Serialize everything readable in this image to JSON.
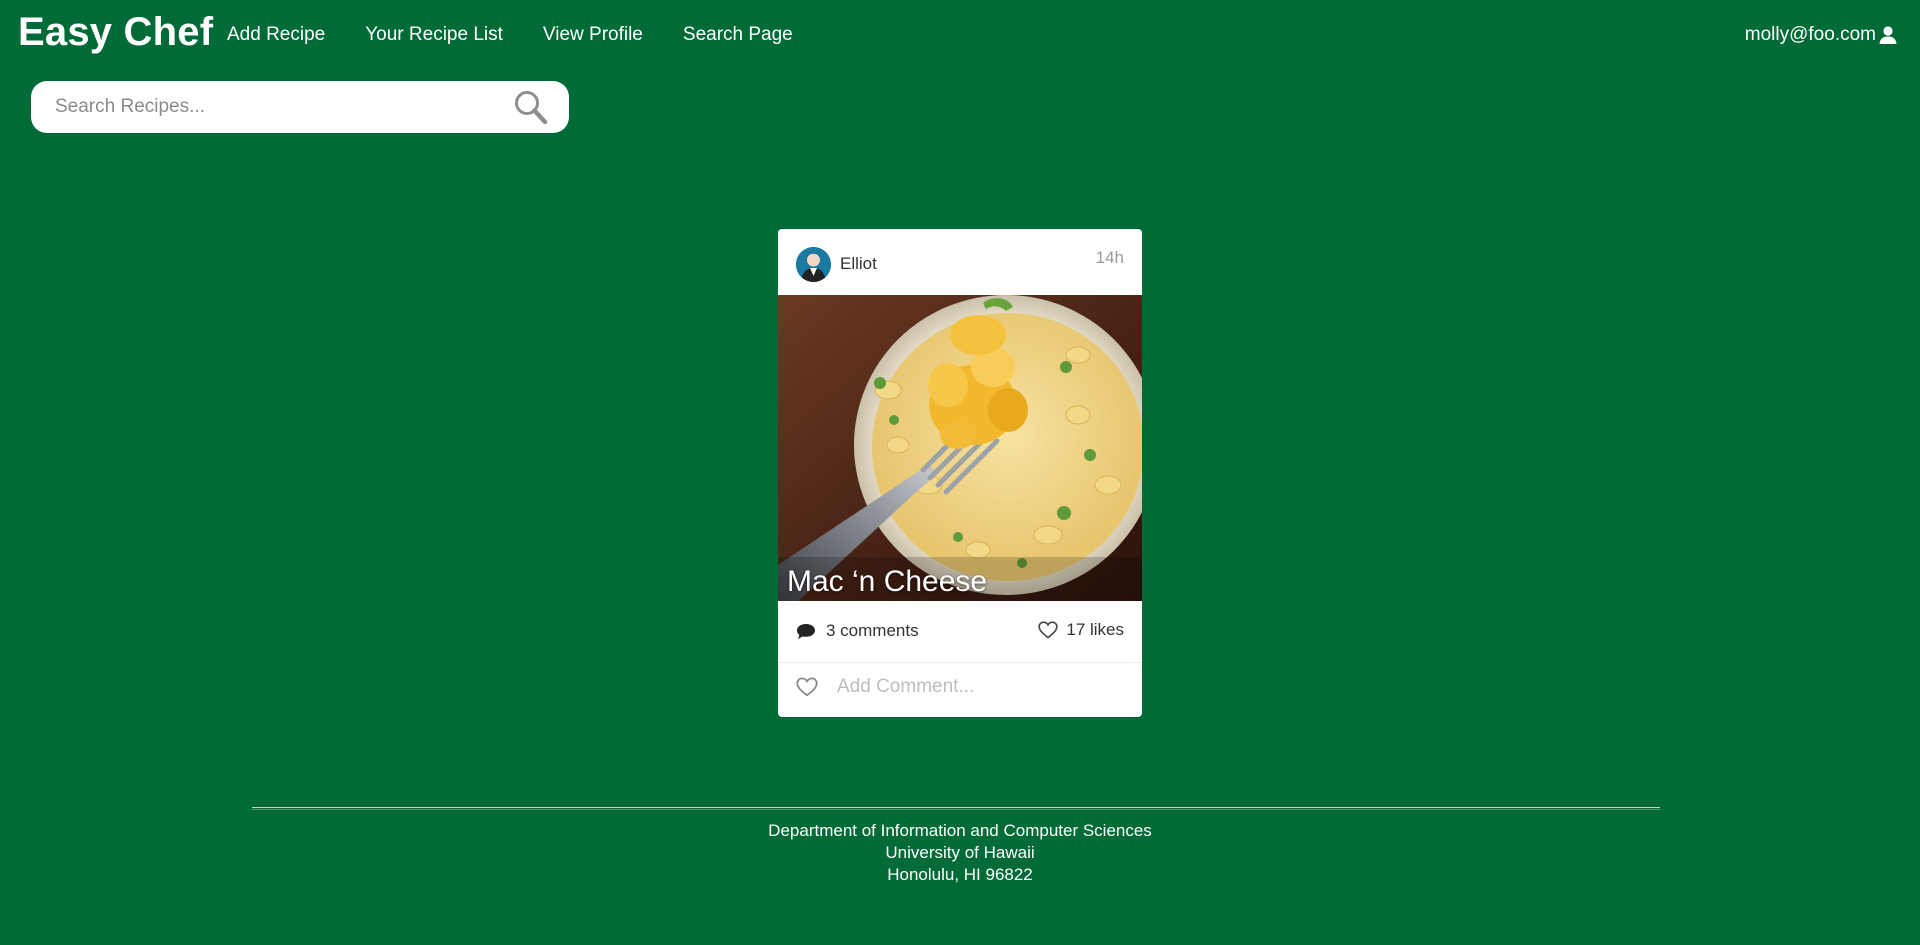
{
  "nav": {
    "brand": "Easy Chef",
    "links": [
      "Add Recipe",
      "Your Recipe List",
      "View Profile",
      "Search Page"
    ],
    "user_email": "molly@foo.com",
    "user_icon": "user-icon"
  },
  "search": {
    "placeholder": "Search Recipes...",
    "icon": "search-icon"
  },
  "card": {
    "author": "Elliot",
    "time": "14h",
    "title": "Mac ‘n Cheese",
    "comments": "3 comments",
    "likes": "17 likes",
    "comment_placeholder": "Add Comment...",
    "icons": [
      "comment-icon",
      "heart-icon"
    ]
  },
  "footer": {
    "lines": [
      "Department of Information and Computer Sciences",
      "University of Hawaii",
      "Honolulu, HI 96822"
    ]
  },
  "colors": {
    "background": "#006b36",
    "card": "#ffffff",
    "text_light": "#ffffff"
  }
}
